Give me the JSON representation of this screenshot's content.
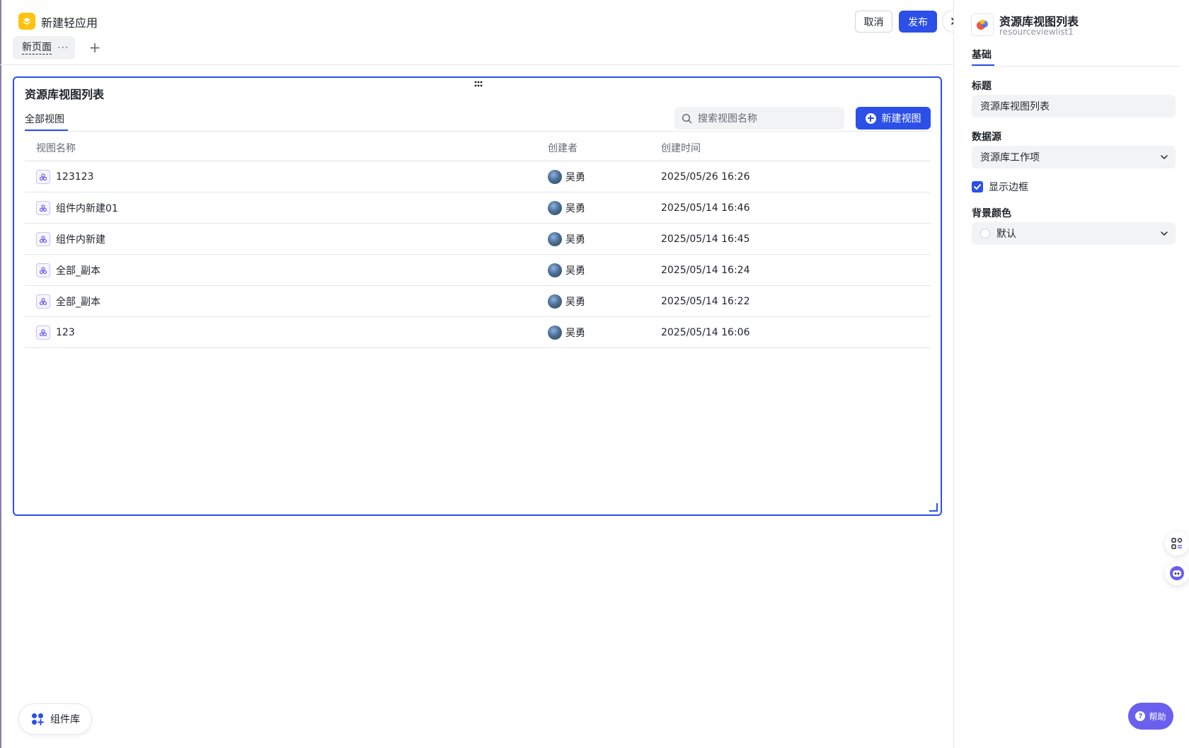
{
  "header": {
    "app_title": "新建轻应用",
    "page_tab": "新页面",
    "page_tab_more": "···",
    "add_page": "+",
    "cancel_label": "取消",
    "publish_label": "发布"
  },
  "widget": {
    "title": "资源库视图列表",
    "tab_all": "全部视图",
    "search_placeholder": "搜索视图名称",
    "new_view_label": "新建视图",
    "columns": {
      "name": "视图名称",
      "creator": "创建者",
      "time": "创建时间"
    },
    "rows": [
      {
        "name": "123123",
        "creator": "吴勇",
        "time": "2025/05/26 16:26"
      },
      {
        "name": "组件内新建01",
        "creator": "吴勇",
        "time": "2025/05/14 16:46"
      },
      {
        "name": "组件内新建",
        "creator": "吴勇",
        "time": "2025/05/14 16:45"
      },
      {
        "name": "全部_副本",
        "creator": "吴勇",
        "time": "2025/05/14 16:24"
      },
      {
        "name": "全部_副本",
        "creator": "吴勇",
        "time": "2025/05/14 16:22"
      },
      {
        "name": "123",
        "creator": "吴勇",
        "time": "2025/05/14 16:06"
      }
    ]
  },
  "panel": {
    "title": "资源库视图列表",
    "subtitle": "resourceviewlist1",
    "tab": "基础",
    "title_label": "标题",
    "title_value": "资源库视图列表",
    "datasource_label": "数据源",
    "datasource_value": "资源库工作项",
    "border_label": "显示边框",
    "border_checked": true,
    "bg_label": "背景颜色",
    "bg_value": "默认"
  },
  "footer": {
    "component_library": "组件库",
    "help": "帮助"
  },
  "colors": {
    "accent": "#2c4fe8",
    "app_icon": "#ffc20e",
    "help": "#6b5ff0"
  }
}
